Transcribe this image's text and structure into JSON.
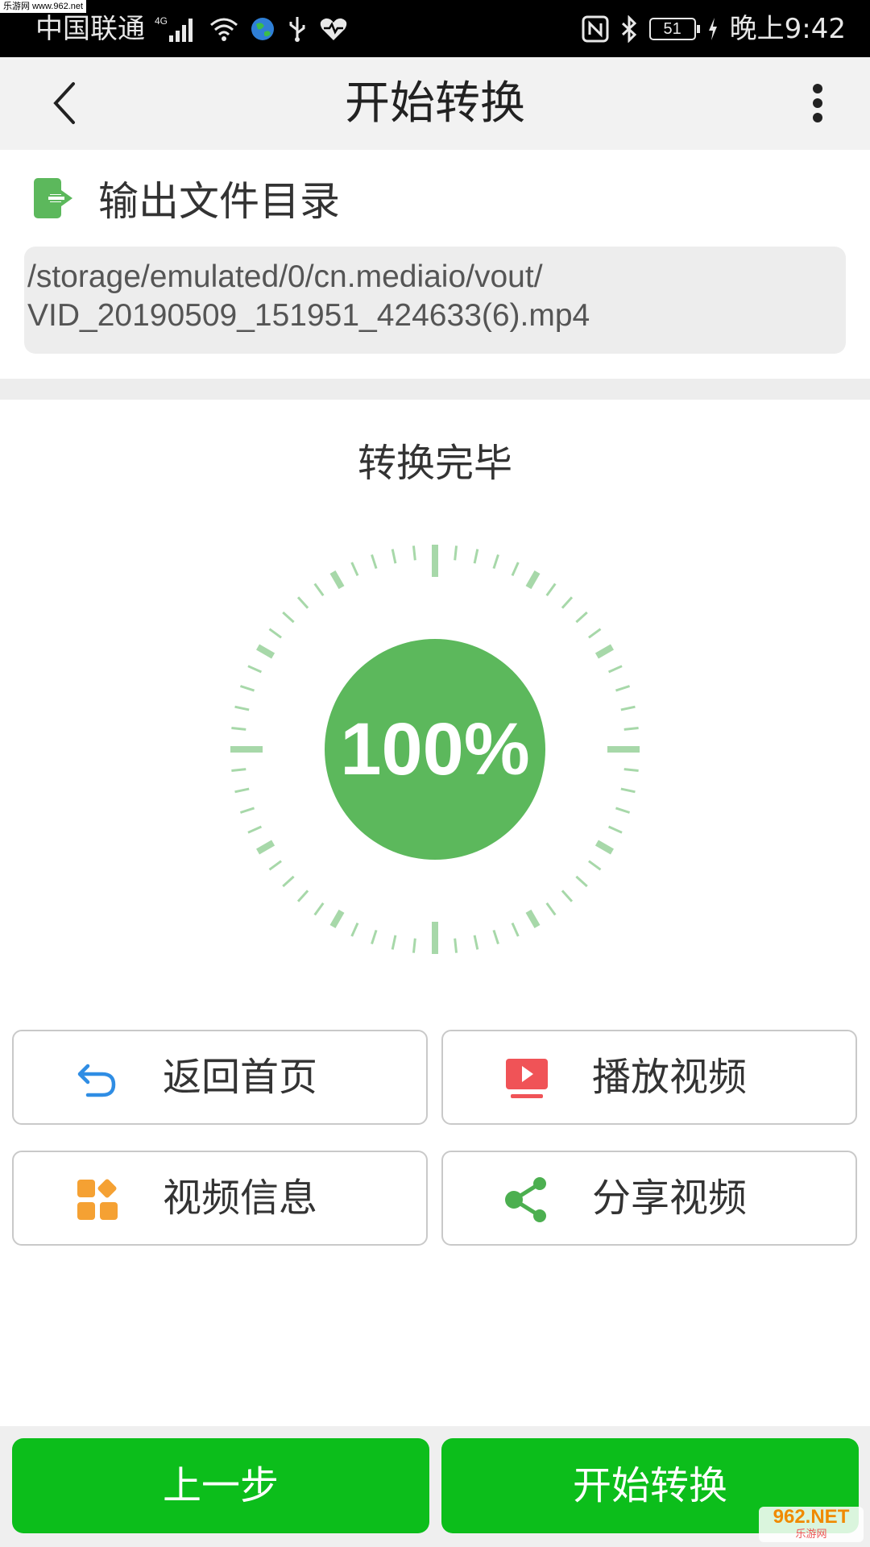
{
  "watermark_top": "乐游网 www.962.net",
  "status_bar": {
    "carrier": "中国联通",
    "network": "4G",
    "battery": "51",
    "time": "晚上9:42"
  },
  "app_bar": {
    "title": "开始转换",
    "back_icon": "chevron-left",
    "menu_icon": "more-vertical"
  },
  "output": {
    "label": "输出文件目录",
    "icon": "export-icon",
    "path_line1": "/storage/emulated/0/cn.mediaio/vout/",
    "path_line2": "VID_20190509_151951_424633(6).mp4"
  },
  "progress": {
    "status": "转换完毕",
    "value": 1.0,
    "label": "100%"
  },
  "actions": [
    {
      "label": "返回首页",
      "icon": "undo-icon",
      "color": "#2f8de4"
    },
    {
      "label": "播放视频",
      "icon": "play-video-icon",
      "color": "#f05357"
    },
    {
      "label": "视频信息",
      "icon": "grid-info-icon",
      "color": "#f5a133"
    },
    {
      "label": "分享视频",
      "icon": "share-icon",
      "color": "#4caf50"
    }
  ],
  "bottom": {
    "prev_label": "上一步",
    "start_label": "开始转换"
  },
  "watermark": {
    "main": "962.NET",
    "sub": "乐游网"
  },
  "colors": {
    "accent_green": "#0cbe1b",
    "dial_green": "#5cb85c",
    "tick_green": "#a7d8a9"
  }
}
